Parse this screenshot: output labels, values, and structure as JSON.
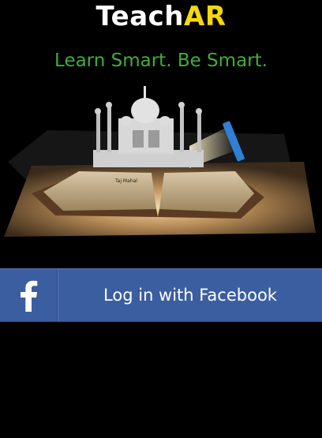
{
  "app": {
    "logo_part1": "Teach",
    "logo_part2": "AR",
    "tagline": "Learn Smart. Be Smart."
  },
  "hero": {
    "book_label": "Taj Mahal"
  },
  "login": {
    "facebook_label": "Log in with Facebook",
    "icon": "facebook-f-icon"
  },
  "colors": {
    "background": "#000000",
    "logo_primary": "#ffffff",
    "logo_accent": "#f5d90a",
    "tagline": "#3fae3a",
    "facebook_blue": "#3b5ea0"
  }
}
